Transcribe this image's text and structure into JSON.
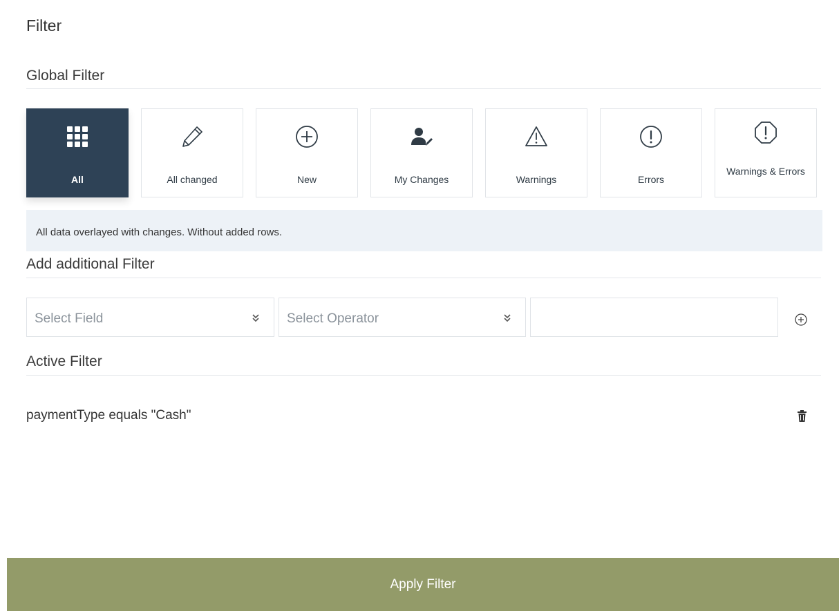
{
  "title": "Filter",
  "global_filter": {
    "heading": "Global Filter",
    "tiles": [
      {
        "label": "All",
        "icon": "grid-icon",
        "selected": true
      },
      {
        "label": "All changed",
        "icon": "pencil-icon",
        "selected": false
      },
      {
        "label": "New",
        "icon": "plus-circle-icon",
        "selected": false
      },
      {
        "label": "My Changes",
        "icon": "user-edit-icon",
        "selected": false
      },
      {
        "label": "Warnings",
        "icon": "warning-triangle-icon",
        "selected": false
      },
      {
        "label": "Errors",
        "icon": "error-circle-icon",
        "selected": false
      },
      {
        "label": "Warnings & Errors",
        "icon": "error-octagon-icon",
        "selected": false
      }
    ],
    "description": "All data overlayed with changes. Without added rows."
  },
  "additional_filter": {
    "heading": "Add additional Filter",
    "field_placeholder": "Select Field",
    "operator_placeholder": "Select Operator",
    "value": ""
  },
  "active_filter": {
    "heading": "Active Filter",
    "items": [
      {
        "text": "paymentType equals \"Cash\""
      }
    ]
  },
  "apply_label": "Apply Filter",
  "colors": {
    "selected_tile": "#2e4256",
    "apply_button": "#939b69",
    "info_bar": "#edf2f7"
  }
}
